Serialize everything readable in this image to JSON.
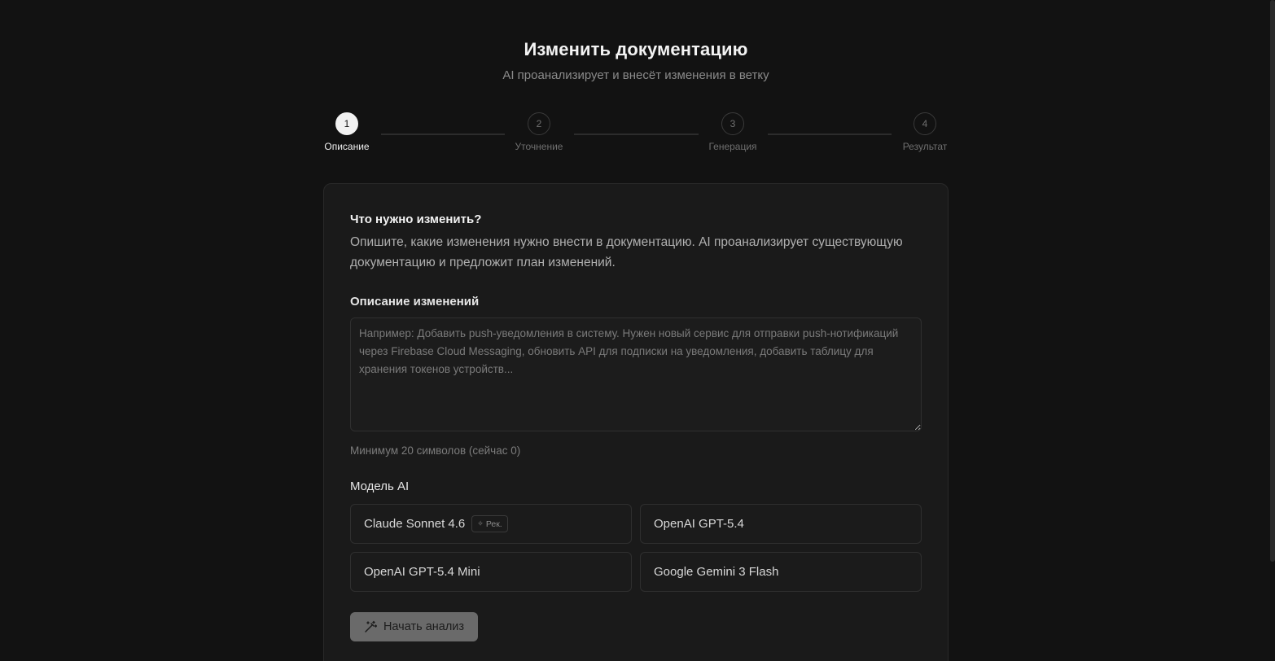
{
  "header": {
    "title": "Изменить документацию",
    "subtitle": "AI проанализирует и внесёт изменения в ветку"
  },
  "stepper": {
    "active_index": 1,
    "steps": [
      {
        "number": "1",
        "label": "Описание"
      },
      {
        "number": "2",
        "label": "Уточнение"
      },
      {
        "number": "3",
        "label": "Генерация"
      },
      {
        "number": "4",
        "label": "Результат"
      }
    ]
  },
  "form": {
    "question_title": "Что нужно изменить?",
    "question_description": "Опишите, какие изменения нужно внести в документацию. AI проанализирует существующую документацию и предложит план изменений.",
    "description_label": "Описание изменений",
    "description_value": "",
    "description_placeholder": "Например: Добавить push-уведомления в систему. Нужен новый сервис для отправки push-нотификаций через Firebase Cloud Messaging, обновить API для подписки на уведомления, добавить таблицу для хранения токенов устройств...",
    "char_hint": "Минимум 20 символов (сейчас 0)",
    "model_label": "Модель AI",
    "models": [
      {
        "name": "Claude Sonnet 4.6",
        "badge": "Рек."
      },
      {
        "name": "OpenAI GPT-5.4",
        "badge": ""
      },
      {
        "name": "OpenAI GPT-5.4 Mini",
        "badge": ""
      },
      {
        "name": "Google Gemini 3 Flash",
        "badge": ""
      }
    ],
    "submit_label": "Начать анализ",
    "submit_icon": "magic-wand-icon",
    "badge_icon": "sparkle-icon"
  }
}
